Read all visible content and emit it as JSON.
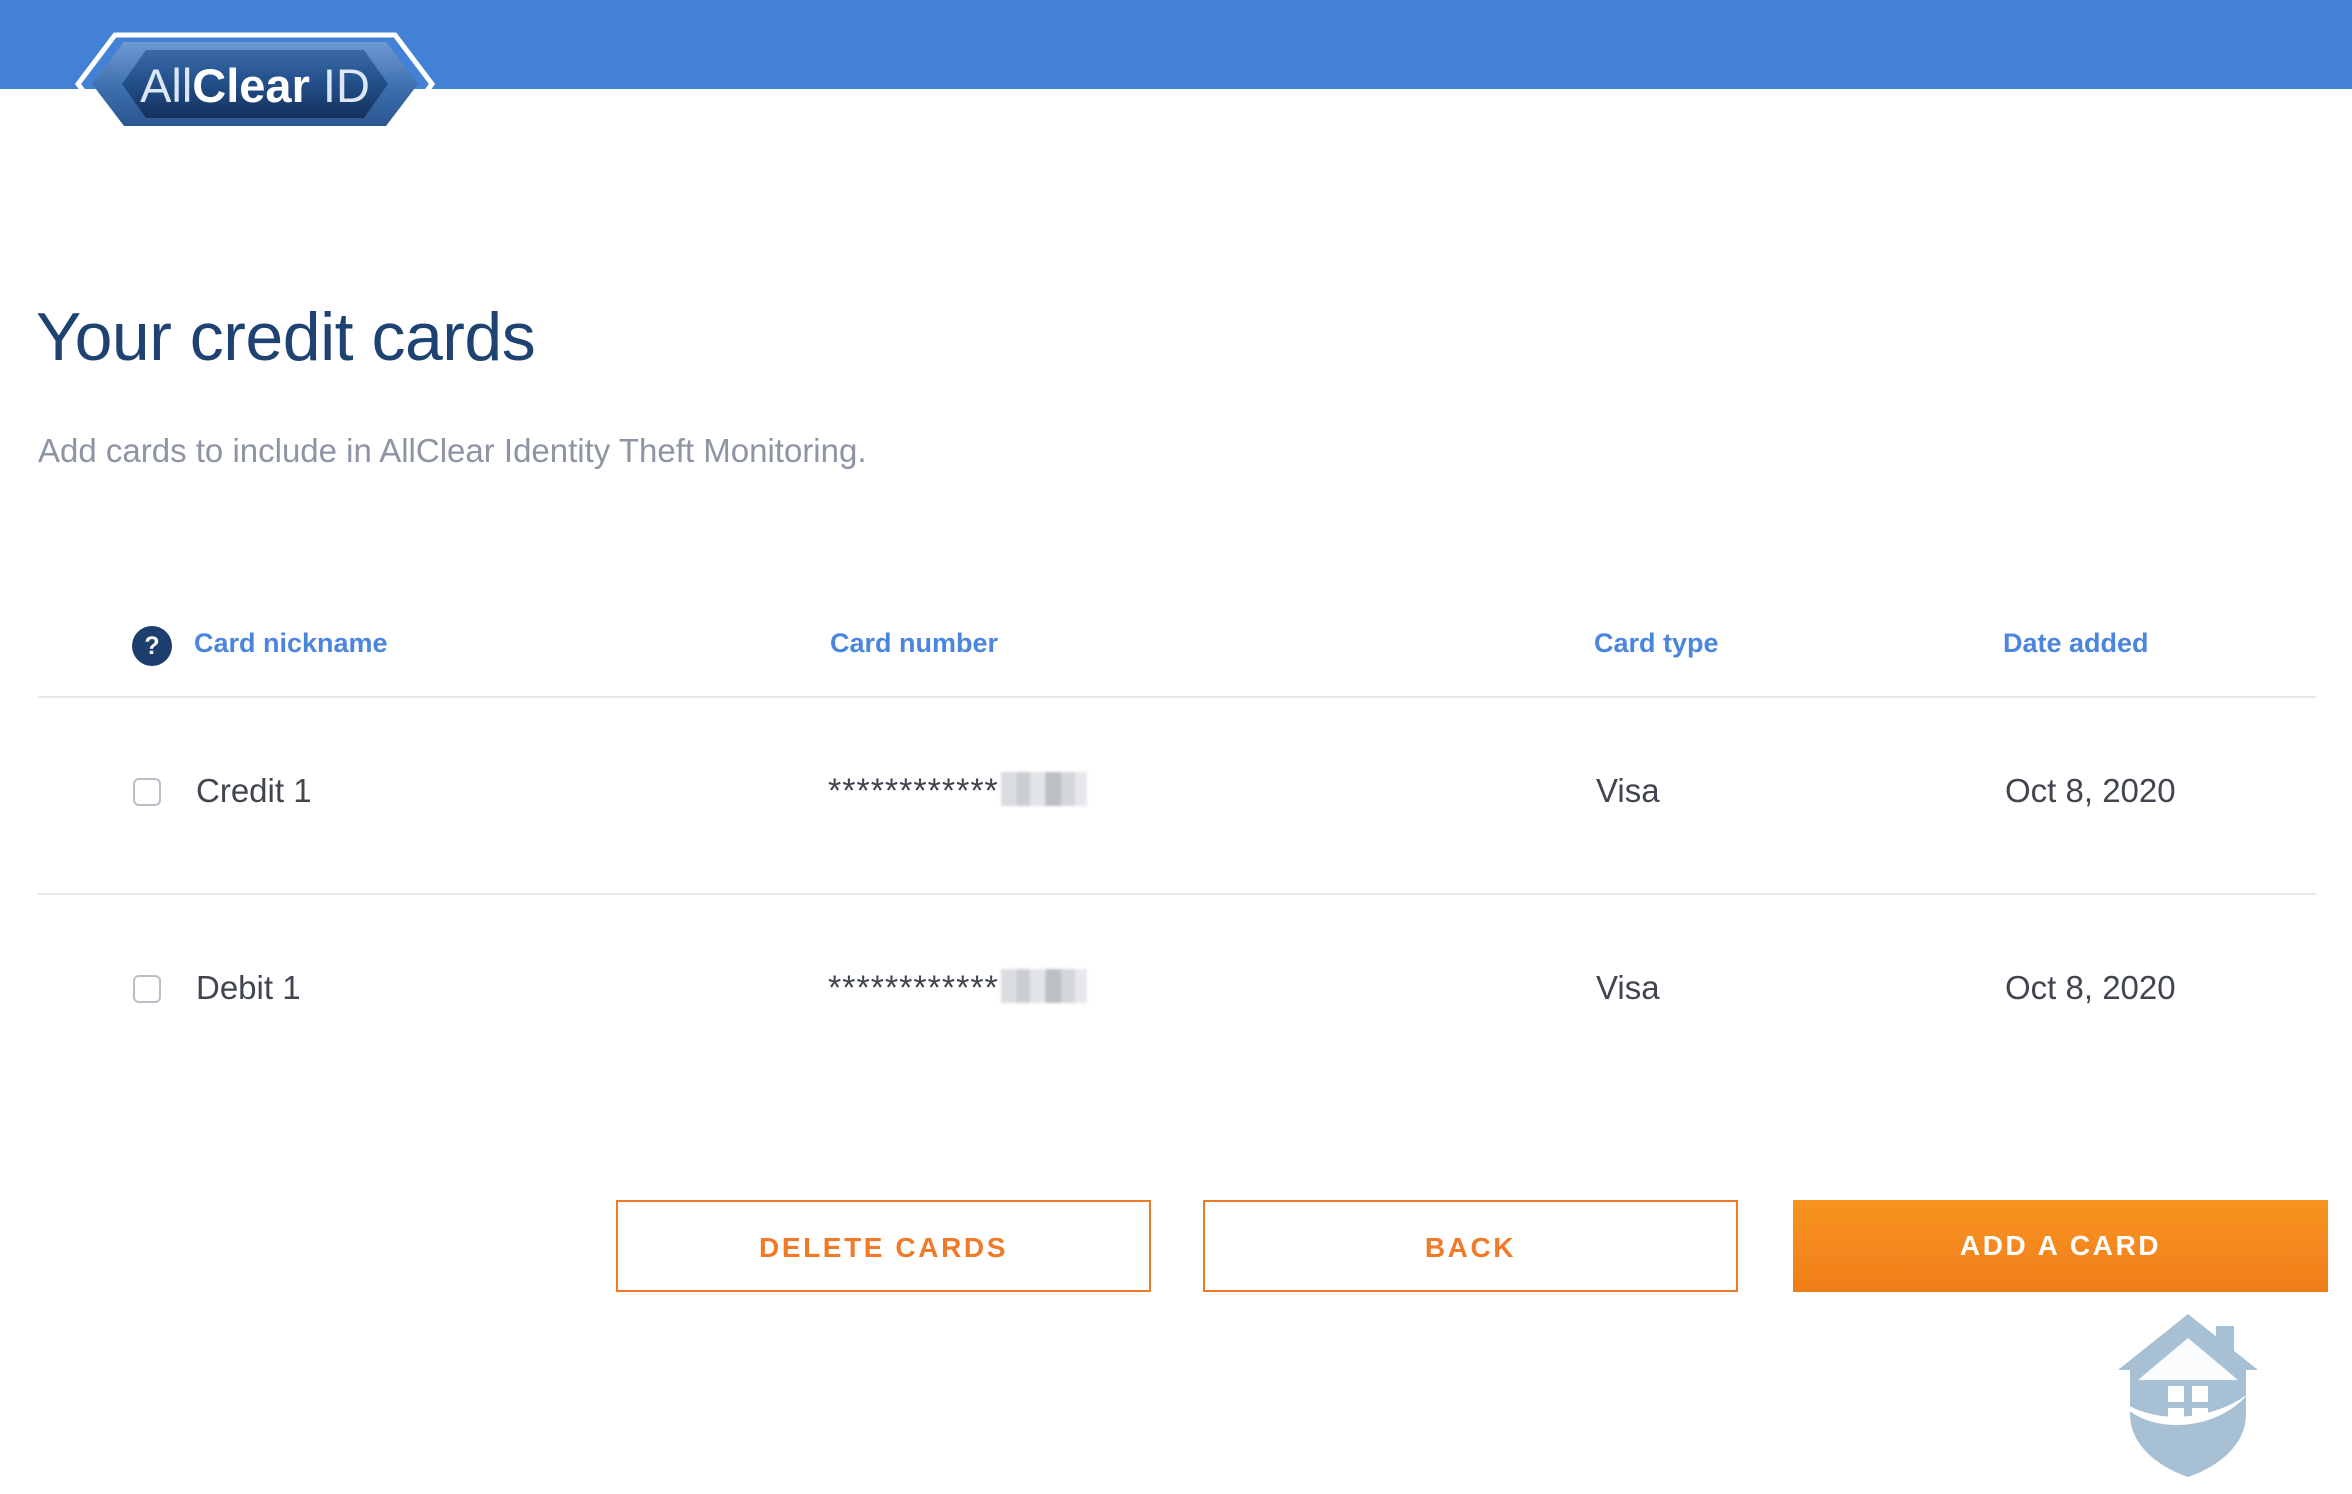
{
  "header": {
    "banner_color": "#4281d3",
    "logo": {
      "text_light": "All",
      "text_bold": "Clear",
      "text_suffix": "ID",
      "alt": "AllClear ID"
    }
  },
  "page": {
    "title": "Your credit cards",
    "subtitle": "Add cards to include in AllClear Identity Theft Monitoring."
  },
  "table": {
    "help_icon_label": "?",
    "columns": [
      {
        "key": "nickname",
        "label": "Card nickname"
      },
      {
        "key": "number",
        "label": "Card number"
      },
      {
        "key": "type",
        "label": "Card type"
      },
      {
        "key": "date",
        "label": "Date added"
      }
    ],
    "rows": [
      {
        "nickname": "Credit 1",
        "number_masked": "************",
        "number_redacted": true,
        "type": "Visa",
        "date": "Oct 8, 2020",
        "checked": false
      },
      {
        "nickname": "Debit 1",
        "number_masked": "************",
        "number_redacted": true,
        "type": "Visa",
        "date": "Oct 8, 2020",
        "checked": false
      }
    ]
  },
  "actions": {
    "delete_label": "DELETE CARDS",
    "back_label": "BACK",
    "add_label": "ADD A CARD"
  },
  "colors": {
    "banner_blue": "#4281d3",
    "title_navy": "#1e4272",
    "subtitle_gray": "#8d94a3",
    "column_header_blue": "#4b85dd",
    "help_badge_navy": "#1d3f6e",
    "accent_orange": "#f07a28",
    "primary_orange": "#f7941e",
    "divider_gray": "#e6e9ed",
    "watermark_blue": "#a8c0d4"
  },
  "watermark": {
    "icon": "house-shield-icon"
  }
}
